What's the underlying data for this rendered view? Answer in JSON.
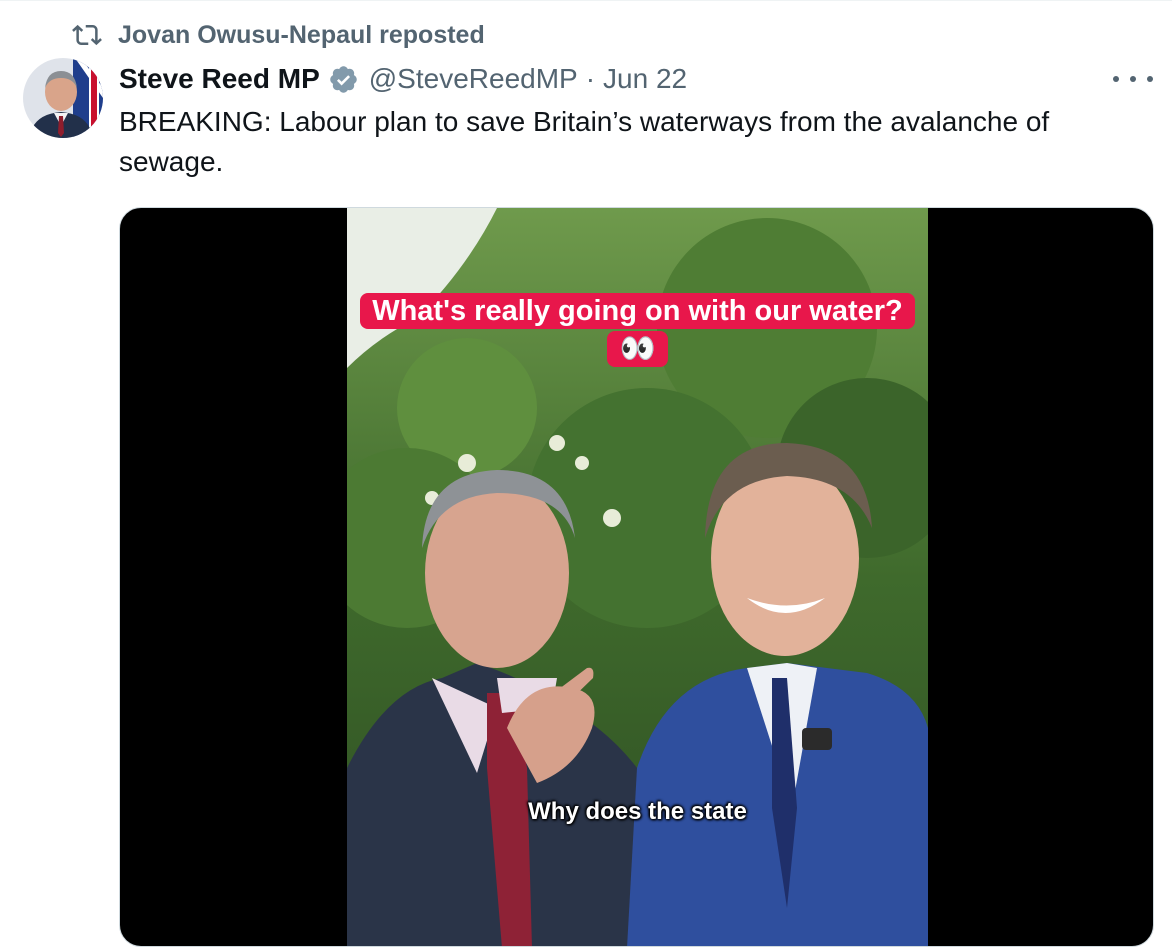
{
  "repost": {
    "icon": "repost-icon",
    "text": "Jovan Owusu-Nepaul reposted"
  },
  "author": {
    "display_name": "Steve Reed MP",
    "verified_icon": "verified-badge-icon",
    "handle": "@SteveReedMP",
    "separator": "·",
    "date": "Jun 22"
  },
  "menu": {
    "icon": "more-options-icon"
  },
  "tweet": {
    "text": "BREAKING: Labour plan to save Britain’s waterways from the avalanche of sewage."
  },
  "video": {
    "caption_top": "What's really going on with our water? 👀",
    "caption_bottom": "Why does the state"
  },
  "colors": {
    "caption_bg": "#e8174b",
    "secondary_text": "#536471",
    "verified": "#829aab"
  }
}
